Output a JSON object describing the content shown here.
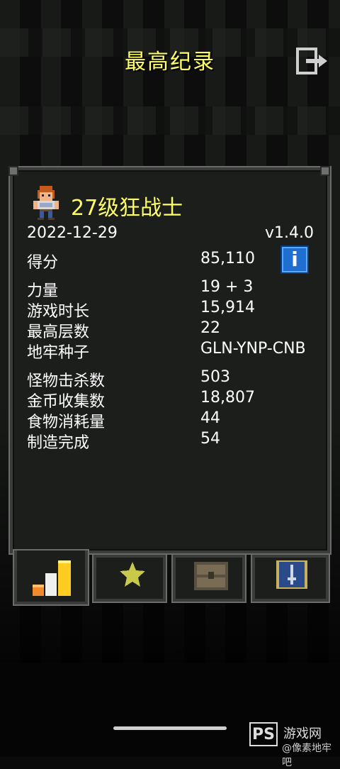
{
  "header": {
    "title": "最高纪录",
    "exit_icon": "exit-door-icon"
  },
  "hero": {
    "icon": "warrior-sprite-icon",
    "title": "27级狂战士",
    "date": "2022-12-29",
    "version": "v1.4.0"
  },
  "stats_group1": [
    {
      "label": "得分",
      "value": "85,110"
    }
  ],
  "stats_group2": [
    {
      "label": "力量",
      "value": "19 + 3"
    },
    {
      "label": "游戏时长",
      "value": "15,914"
    },
    {
      "label": "最高层数",
      "value": "22"
    },
    {
      "label": "地牢种子",
      "value": "GLN-YNP-CNB"
    }
  ],
  "stats_group3": [
    {
      "label": "怪物击杀数",
      "value": "503"
    },
    {
      "label": "金币收集数",
      "value": "18,807"
    },
    {
      "label": "食物消耗量",
      "value": "44"
    },
    {
      "label": "制造完成",
      "value": "54"
    }
  ],
  "info_button": {
    "label": "i",
    "icon": "info-icon"
  },
  "tabs": [
    {
      "icon": "bar-chart-icon",
      "active": true
    },
    {
      "icon": "star-icon",
      "active": false
    },
    {
      "icon": "chest-icon",
      "active": false
    },
    {
      "icon": "journal-icon",
      "active": false
    }
  ],
  "watermark": {
    "badge": "PS",
    "site": "游戏网",
    "tagline": "@像素地牢吧"
  },
  "colors": {
    "title_yellow": "#ffff66",
    "panel_bg": "#1c1e1c",
    "panel_border": "#3a3c3a",
    "info_blue": "#1e6fcf"
  }
}
